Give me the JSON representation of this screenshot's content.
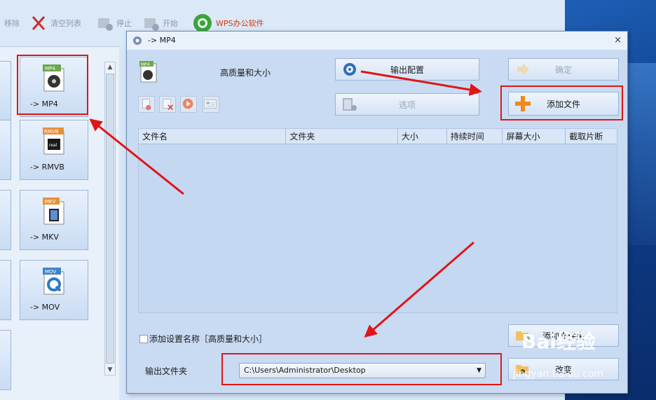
{
  "toolbar": {
    "items": [
      {
        "label": "移除",
        "active": false
      },
      {
        "label": "清空列表",
        "active": false
      },
      {
        "label": "停止",
        "active": false
      },
      {
        "label": "开始",
        "active": false
      },
      {
        "label": "WPS办公软件",
        "active": true
      }
    ]
  },
  "formats": [
    {
      "label": "-> MP4",
      "badge": "MP4",
      "badge_color": "#6aa84f"
    },
    {
      "label": "-> RMVB",
      "badge": "RMVB",
      "badge_color": "#e69138"
    },
    {
      "label": "-> MKV",
      "badge": "MKV",
      "badge_color": "#e69138"
    },
    {
      "label": "-> MOV",
      "badge": "MOV",
      "badge_color": "#3d85c6"
    }
  ],
  "dialog": {
    "title": "-> MP4",
    "close_label": "×",
    "quality_label": "高质量和大小",
    "output_config_label": "输出配置",
    "options_label": "选项",
    "confirm_label": "确定",
    "add_file_label": "添加文件",
    "add_folder_label": "添加文件夹",
    "change_label": "改变",
    "table_headers": [
      "文件名",
      "文件夹",
      "大小",
      "持续时间",
      "屏幕大小",
      "截取片断"
    ],
    "rows": [],
    "checkbox_label": "添加设置名称［高质量和大小］",
    "output_folder_label": "输出文件夹",
    "output_path": "C:\\Users\\Administrator\\Desktop"
  },
  "annotation_color": "#e01515",
  "watermark": {
    "logo": "Bai经验",
    "url": "jingyan.baidu.com"
  }
}
